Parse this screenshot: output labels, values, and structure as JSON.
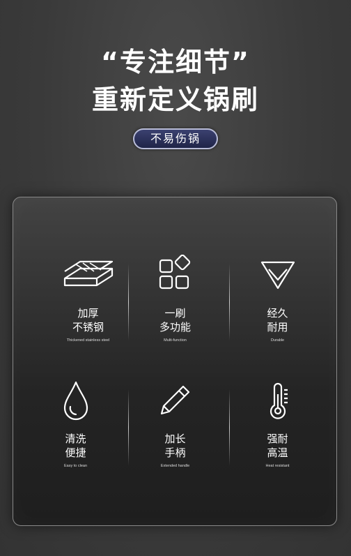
{
  "headline": {
    "line1": "“专注细节”",
    "line2": "重新定义锅刷"
  },
  "badge": {
    "label": "不易伤锅"
  },
  "features": [
    {
      "icon": "layers-icon",
      "zh1": "加厚",
      "zh2": "不锈钢",
      "en": "Thickened stainless steel"
    },
    {
      "icon": "grid-icon",
      "zh1": "一刷",
      "zh2": "多功能",
      "en": "Multi-function"
    },
    {
      "icon": "diamond-icon",
      "zh1": "经久",
      "zh2": "耐用",
      "en": "Durable"
    },
    {
      "icon": "water-drop-icon",
      "zh1": "清洗",
      "zh2": "便捷",
      "en": "Easy to clean"
    },
    {
      "icon": "pencil-icon",
      "zh1": "加长",
      "zh2": "手柄",
      "en": "Extended handle"
    },
    {
      "icon": "thermometer-icon",
      "zh1": "强耐",
      "zh2": "高温",
      "en": "Heat resistant"
    }
  ]
}
